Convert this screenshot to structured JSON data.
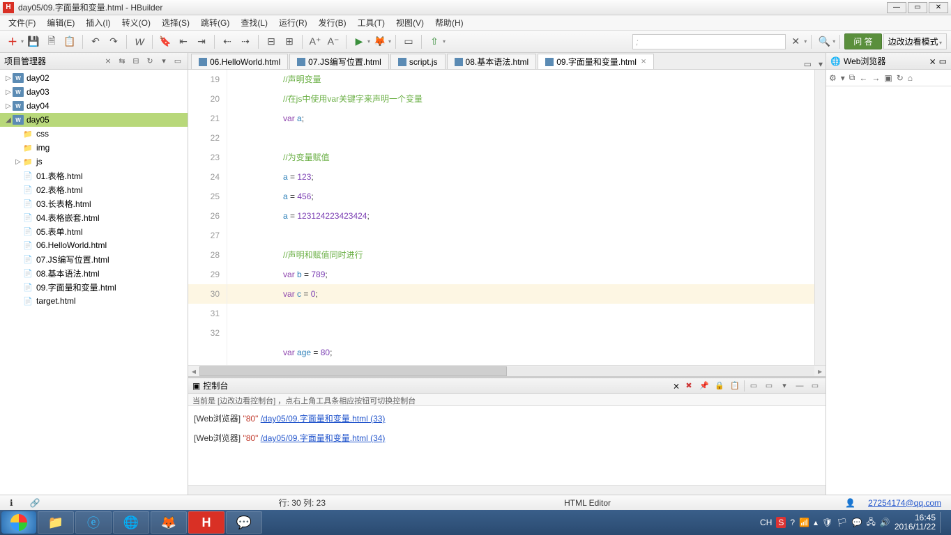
{
  "title": "day05/09.字面量和变量.html  -  HBuilder",
  "app_icon_letter": "H",
  "menu": [
    "文件(F)",
    "编辑(E)",
    "插入(I)",
    "转义(O)",
    "选择(S)",
    "跳转(G)",
    "查找(L)",
    "运行(R)",
    "发行(B)",
    "工具(T)",
    "视图(V)",
    "帮助(H)"
  ],
  "toolbar": {
    "search_placeholder": ";",
    "qa_label": "问 答",
    "mode_label": "边改边看模式"
  },
  "sidebar": {
    "title": "项目管理器",
    "close_char": "⨯",
    "items": [
      {
        "type": "proj",
        "label": "day02",
        "indent": 0,
        "tw": "▷"
      },
      {
        "type": "proj",
        "label": "day03",
        "indent": 0,
        "tw": "▷"
      },
      {
        "type": "proj",
        "label": "day04",
        "indent": 0,
        "tw": "▷"
      },
      {
        "type": "proj",
        "label": "day05",
        "indent": 0,
        "tw": "◢",
        "selected": true
      },
      {
        "type": "dir",
        "label": "css",
        "indent": 1,
        "tw": ""
      },
      {
        "type": "dir",
        "label": "img",
        "indent": 1,
        "tw": ""
      },
      {
        "type": "dir",
        "label": "js",
        "indent": 1,
        "tw": "▷"
      },
      {
        "type": "file",
        "label": "01.表格.html",
        "indent": 1,
        "tw": ""
      },
      {
        "type": "file",
        "label": "02.表格.html",
        "indent": 1,
        "tw": ""
      },
      {
        "type": "file",
        "label": "03.长表格.html",
        "indent": 1,
        "tw": ""
      },
      {
        "type": "file",
        "label": "04.表格嵌套.html",
        "indent": 1,
        "tw": ""
      },
      {
        "type": "file",
        "label": "05.表单.html",
        "indent": 1,
        "tw": ""
      },
      {
        "type": "file",
        "label": "06.HelloWorld.html",
        "indent": 1,
        "tw": ""
      },
      {
        "type": "file",
        "label": "07.JS编写位置.html",
        "indent": 1,
        "tw": ""
      },
      {
        "type": "file",
        "label": "08.基本语法.html",
        "indent": 1,
        "tw": ""
      },
      {
        "type": "file",
        "label": "09.字面量和变量.html",
        "indent": 1,
        "tw": ""
      },
      {
        "type": "file",
        "label": "target.html",
        "indent": 1,
        "tw": ""
      }
    ]
  },
  "tabs": [
    {
      "label": "06.HelloWorld.html",
      "active": false
    },
    {
      "label": "07.JS编写位置.html",
      "active": false
    },
    {
      "label": "script.js",
      "active": false
    },
    {
      "label": "08.基本语法.html",
      "active": false
    },
    {
      "label": "09.字面量和变量.html",
      "active": true
    }
  ],
  "gutter": [
    "19",
    "20",
    "21",
    "22",
    "23",
    "24",
    "25",
    "26",
    "27",
    "28",
    "29",
    "30",
    "31",
    "32"
  ],
  "code_lines": [
    {
      "tokens": [
        {
          "t": "//声明变量",
          "c": "comment"
        }
      ]
    },
    {
      "tokens": [
        {
          "t": "//在js中使用var关键字来声明一个变量",
          "c": "comment"
        }
      ]
    },
    {
      "tokens": [
        {
          "t": "var",
          "c": "keyword"
        },
        {
          "t": " a",
          "c": "ident"
        },
        {
          "t": ";",
          "c": "punct"
        }
      ]
    },
    {
      "tokens": []
    },
    {
      "tokens": [
        {
          "t": "//为变量赋值",
          "c": "comment"
        }
      ]
    },
    {
      "tokens": [
        {
          "t": "a ",
          "c": "ident"
        },
        {
          "t": "= ",
          "c": "punct"
        },
        {
          "t": "123",
          "c": "number"
        },
        {
          "t": ";",
          "c": "punct"
        }
      ]
    },
    {
      "tokens": [
        {
          "t": "a ",
          "c": "ident"
        },
        {
          "t": "= ",
          "c": "punct"
        },
        {
          "t": "456",
          "c": "number"
        },
        {
          "t": ";",
          "c": "punct"
        }
      ]
    },
    {
      "tokens": [
        {
          "t": "a ",
          "c": "ident"
        },
        {
          "t": "= ",
          "c": "punct"
        },
        {
          "t": "123124223423424",
          "c": "number"
        },
        {
          "t": ";",
          "c": "punct"
        }
      ]
    },
    {
      "tokens": []
    },
    {
      "tokens": [
        {
          "t": "//声明和赋值同时进行",
          "c": "comment"
        }
      ]
    },
    {
      "tokens": [
        {
          "t": "var",
          "c": "keyword"
        },
        {
          "t": " b ",
          "c": "ident"
        },
        {
          "t": "= ",
          "c": "punct"
        },
        {
          "t": "789",
          "c": "number"
        },
        {
          "t": ";",
          "c": "punct"
        }
      ]
    },
    {
      "tokens": [
        {
          "t": "var",
          "c": "keyword"
        },
        {
          "t": " c ",
          "c": "ident"
        },
        {
          "t": "= ",
          "c": "punct"
        },
        {
          "t": "0",
          "c": "number"
        },
        {
          "t": ";",
          "c": "punct"
        }
      ],
      "hl": true
    },
    {
      "tokens": []
    },
    {
      "tokens": [
        {
          "t": "var",
          "c": "keyword"
        },
        {
          "t": " age ",
          "c": "ident"
        },
        {
          "t": "= ",
          "c": "punct"
        },
        {
          "t": "80",
          "c": "number"
        },
        {
          "t": ";",
          "c": "punct"
        }
      ]
    }
  ],
  "console": {
    "title": "控制台",
    "close_char": "⨯",
    "hint": "当前是 [边改边看控制台] ，点右上角工具条相应按钮可切换控制台",
    "rows": [
      {
        "tag": "[Web浏览器]",
        "val": "\"80\"",
        "link": "/day05/09.字面量和变量.html (33)"
      },
      {
        "tag": "[Web浏览器]",
        "val": "\"80\"",
        "link": "/day05/09.字面量和变量.html (34)"
      }
    ]
  },
  "rightpanel": {
    "title": "Web浏览器",
    "close_char": "⨯"
  },
  "status": {
    "cursor": "行: 30 列: 23",
    "editor": "HTML Editor",
    "user": "27254174@qq.com"
  },
  "tray": {
    "time": "16:45",
    "date": "2016/11/22",
    "ime": "CH"
  }
}
